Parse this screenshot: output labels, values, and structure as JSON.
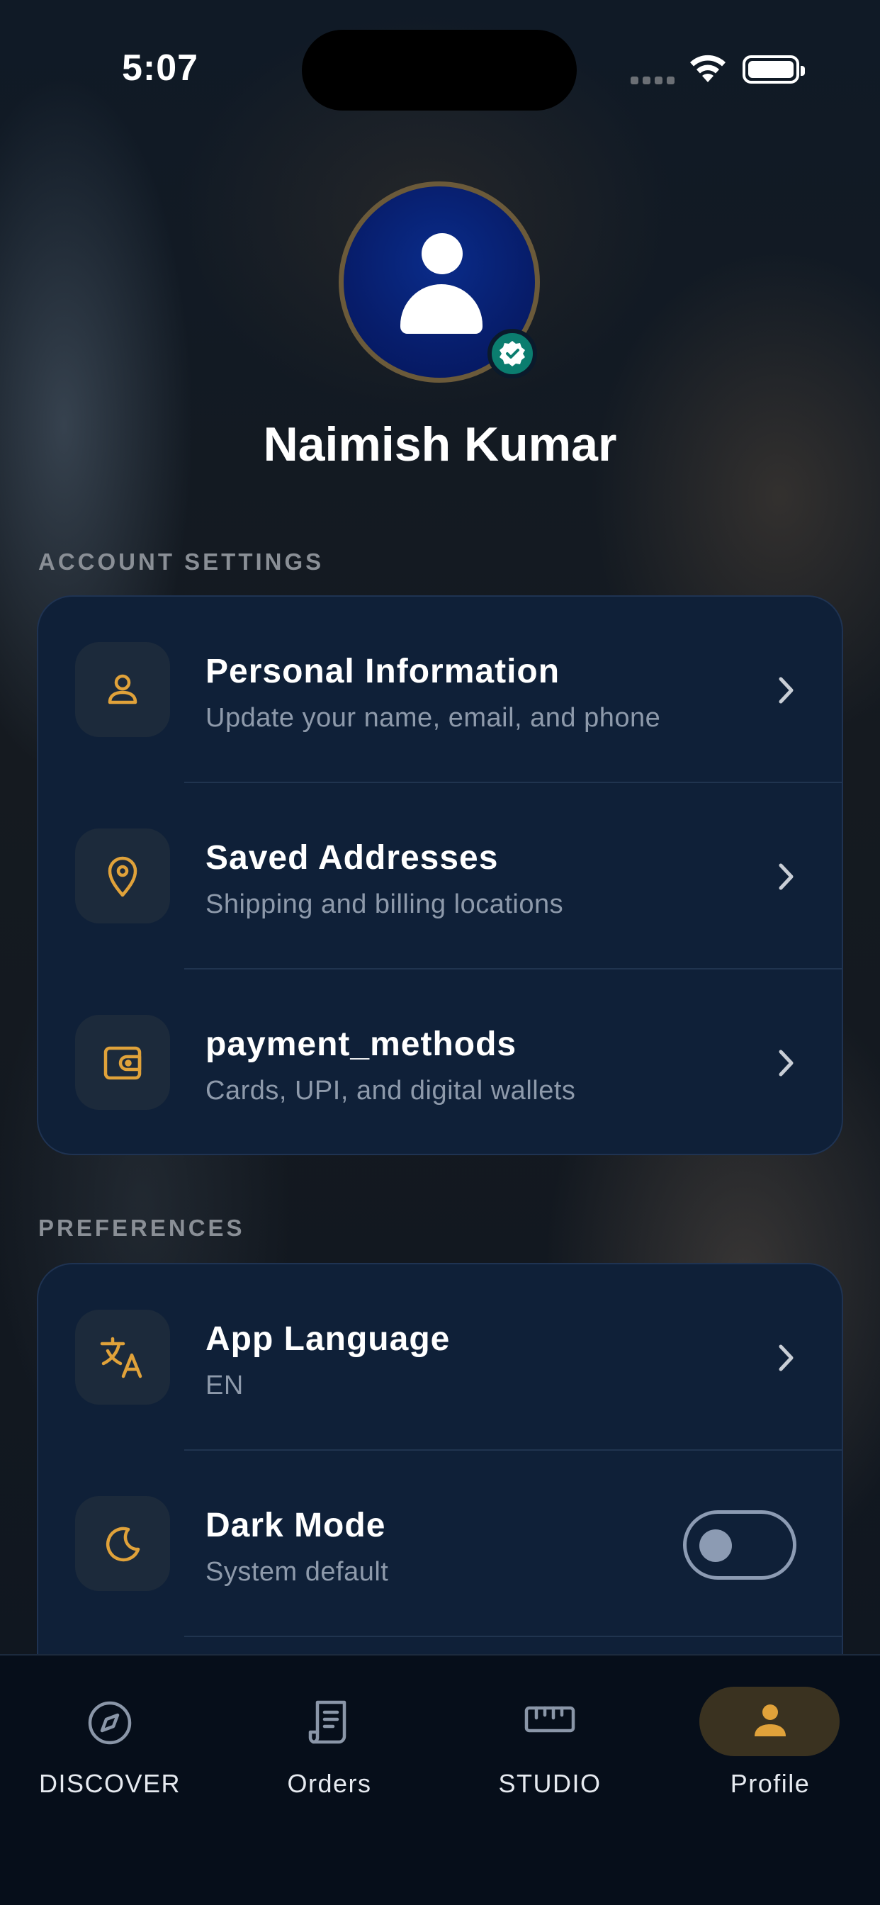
{
  "status_bar": {
    "time": "5:07"
  },
  "profile": {
    "name": "Naimish Kumar"
  },
  "account_settings": {
    "label": "ACCOUNT SETTINGS",
    "items": [
      {
        "title": "Personal Information",
        "subtitle": "Update your name, email, and phone",
        "icon": "person-icon"
      },
      {
        "title": "Saved Addresses",
        "subtitle": "Shipping and billing locations",
        "icon": "location-pin-icon"
      },
      {
        "title": "payment_methods",
        "subtitle": "Cards, UPI, and digital wallets",
        "icon": "wallet-icon"
      }
    ]
  },
  "preferences": {
    "label": "PREFERENCES",
    "items": [
      {
        "title": "App Language",
        "subtitle": "EN",
        "icon": "translate-icon"
      },
      {
        "title": "Dark Mode",
        "subtitle": "System default",
        "icon": "moon-icon",
        "toggle_on": false
      }
    ]
  },
  "tabs": [
    {
      "label": "DISCOVER",
      "icon": "compass-icon",
      "active": false
    },
    {
      "label": "Orders",
      "icon": "receipt-icon",
      "active": false
    },
    {
      "label": "STUDIO",
      "icon": "ruler-icon",
      "active": false
    },
    {
      "label": "Profile",
      "icon": "person-icon",
      "active": true
    }
  ],
  "colors": {
    "accent": "#E0A23A",
    "card_bg": "#0F2038",
    "verified": "#0B7D6F",
    "active_tab_pill": "#3A3220"
  }
}
